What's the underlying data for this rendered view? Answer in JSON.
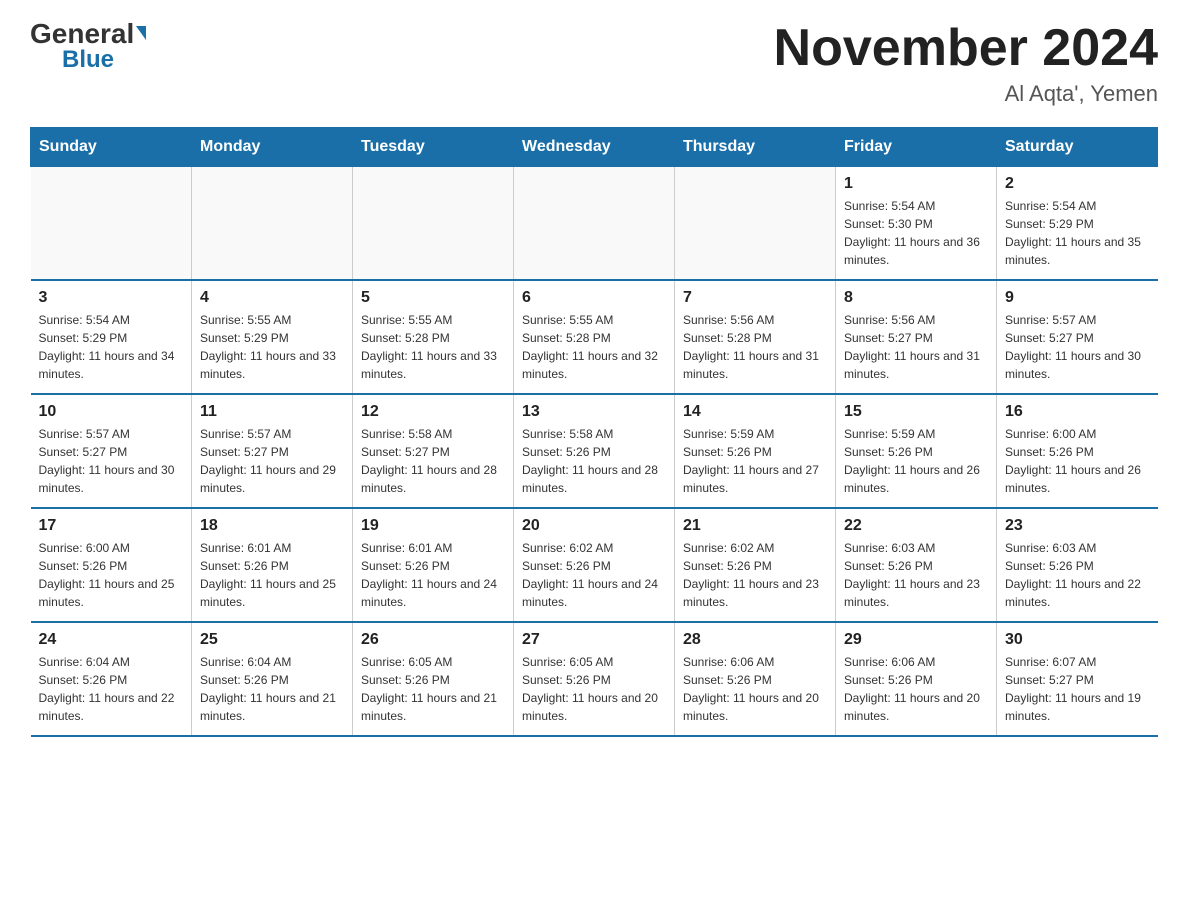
{
  "logo": {
    "general": "General",
    "blue": "Blue"
  },
  "title": "November 2024",
  "location": "Al Aqta', Yemen",
  "days_of_week": [
    "Sunday",
    "Monday",
    "Tuesday",
    "Wednesday",
    "Thursday",
    "Friday",
    "Saturday"
  ],
  "weeks": [
    [
      {
        "day": "",
        "info": ""
      },
      {
        "day": "",
        "info": ""
      },
      {
        "day": "",
        "info": ""
      },
      {
        "day": "",
        "info": ""
      },
      {
        "day": "",
        "info": ""
      },
      {
        "day": "1",
        "info": "Sunrise: 5:54 AM\nSunset: 5:30 PM\nDaylight: 11 hours and 36 minutes."
      },
      {
        "day": "2",
        "info": "Sunrise: 5:54 AM\nSunset: 5:29 PM\nDaylight: 11 hours and 35 minutes."
      }
    ],
    [
      {
        "day": "3",
        "info": "Sunrise: 5:54 AM\nSunset: 5:29 PM\nDaylight: 11 hours and 34 minutes."
      },
      {
        "day": "4",
        "info": "Sunrise: 5:55 AM\nSunset: 5:29 PM\nDaylight: 11 hours and 33 minutes."
      },
      {
        "day": "5",
        "info": "Sunrise: 5:55 AM\nSunset: 5:28 PM\nDaylight: 11 hours and 33 minutes."
      },
      {
        "day": "6",
        "info": "Sunrise: 5:55 AM\nSunset: 5:28 PM\nDaylight: 11 hours and 32 minutes."
      },
      {
        "day": "7",
        "info": "Sunrise: 5:56 AM\nSunset: 5:28 PM\nDaylight: 11 hours and 31 minutes."
      },
      {
        "day": "8",
        "info": "Sunrise: 5:56 AM\nSunset: 5:27 PM\nDaylight: 11 hours and 31 minutes."
      },
      {
        "day": "9",
        "info": "Sunrise: 5:57 AM\nSunset: 5:27 PM\nDaylight: 11 hours and 30 minutes."
      }
    ],
    [
      {
        "day": "10",
        "info": "Sunrise: 5:57 AM\nSunset: 5:27 PM\nDaylight: 11 hours and 30 minutes."
      },
      {
        "day": "11",
        "info": "Sunrise: 5:57 AM\nSunset: 5:27 PM\nDaylight: 11 hours and 29 minutes."
      },
      {
        "day": "12",
        "info": "Sunrise: 5:58 AM\nSunset: 5:27 PM\nDaylight: 11 hours and 28 minutes."
      },
      {
        "day": "13",
        "info": "Sunrise: 5:58 AM\nSunset: 5:26 PM\nDaylight: 11 hours and 28 minutes."
      },
      {
        "day": "14",
        "info": "Sunrise: 5:59 AM\nSunset: 5:26 PM\nDaylight: 11 hours and 27 minutes."
      },
      {
        "day": "15",
        "info": "Sunrise: 5:59 AM\nSunset: 5:26 PM\nDaylight: 11 hours and 26 minutes."
      },
      {
        "day": "16",
        "info": "Sunrise: 6:00 AM\nSunset: 5:26 PM\nDaylight: 11 hours and 26 minutes."
      }
    ],
    [
      {
        "day": "17",
        "info": "Sunrise: 6:00 AM\nSunset: 5:26 PM\nDaylight: 11 hours and 25 minutes."
      },
      {
        "day": "18",
        "info": "Sunrise: 6:01 AM\nSunset: 5:26 PM\nDaylight: 11 hours and 25 minutes."
      },
      {
        "day": "19",
        "info": "Sunrise: 6:01 AM\nSunset: 5:26 PM\nDaylight: 11 hours and 24 minutes."
      },
      {
        "day": "20",
        "info": "Sunrise: 6:02 AM\nSunset: 5:26 PM\nDaylight: 11 hours and 24 minutes."
      },
      {
        "day": "21",
        "info": "Sunrise: 6:02 AM\nSunset: 5:26 PM\nDaylight: 11 hours and 23 minutes."
      },
      {
        "day": "22",
        "info": "Sunrise: 6:03 AM\nSunset: 5:26 PM\nDaylight: 11 hours and 23 minutes."
      },
      {
        "day": "23",
        "info": "Sunrise: 6:03 AM\nSunset: 5:26 PM\nDaylight: 11 hours and 22 minutes."
      }
    ],
    [
      {
        "day": "24",
        "info": "Sunrise: 6:04 AM\nSunset: 5:26 PM\nDaylight: 11 hours and 22 minutes."
      },
      {
        "day": "25",
        "info": "Sunrise: 6:04 AM\nSunset: 5:26 PM\nDaylight: 11 hours and 21 minutes."
      },
      {
        "day": "26",
        "info": "Sunrise: 6:05 AM\nSunset: 5:26 PM\nDaylight: 11 hours and 21 minutes."
      },
      {
        "day": "27",
        "info": "Sunrise: 6:05 AM\nSunset: 5:26 PM\nDaylight: 11 hours and 20 minutes."
      },
      {
        "day": "28",
        "info": "Sunrise: 6:06 AM\nSunset: 5:26 PM\nDaylight: 11 hours and 20 minutes."
      },
      {
        "day": "29",
        "info": "Sunrise: 6:06 AM\nSunset: 5:26 PM\nDaylight: 11 hours and 20 minutes."
      },
      {
        "day": "30",
        "info": "Sunrise: 6:07 AM\nSunset: 5:27 PM\nDaylight: 11 hours and 19 minutes."
      }
    ]
  ]
}
